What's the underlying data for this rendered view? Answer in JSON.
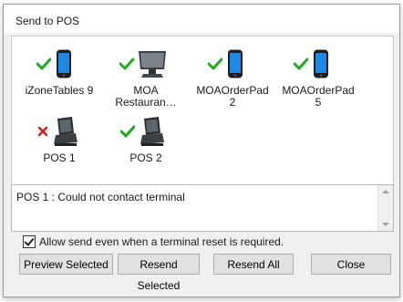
{
  "window": {
    "title": "Send to POS"
  },
  "terminals": [
    {
      "label": "iZoneTables 9",
      "status": "success",
      "device": "phone"
    },
    {
      "label": "MOA\nRestauran…",
      "status": "success",
      "device": "monitor"
    },
    {
      "label": "MOAOrderPad\n2",
      "status": "success",
      "device": "phone"
    },
    {
      "label": "MOAOrderPad\n5",
      "status": "success",
      "device": "phone"
    },
    {
      "label": "POS 1",
      "status": "error",
      "device": "pos"
    },
    {
      "label": "POS 2",
      "status": "success",
      "device": "pos"
    }
  ],
  "log": {
    "text": "POS 1 : Could not contact terminal"
  },
  "options": {
    "allow_reset_label": "Allow send even when a terminal reset is required.",
    "allow_reset_checked": true
  },
  "buttons": {
    "preview": "Preview Selected",
    "resend_selected": "Resend Selected",
    "resend_all": "Resend All",
    "close": "Close"
  },
  "colors": {
    "success": "#1faa1f",
    "error": "#d81e1e",
    "phone_screen": "#1e88e5"
  }
}
